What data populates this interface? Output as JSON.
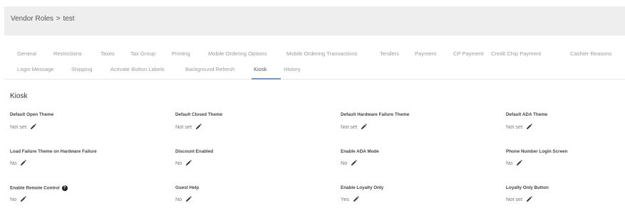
{
  "breadcrumb": {
    "parent": "Vendor Roles",
    "separator": ">",
    "current": "test"
  },
  "tabs": [
    {
      "label": "General"
    },
    {
      "label": "Restrictions"
    },
    {
      "label": "Taxes"
    },
    {
      "label": "Tax Group"
    },
    {
      "label": "Printing"
    },
    {
      "label": "Mobile Ordering Options"
    },
    {
      "label": "Mobile Ordering Transactions"
    },
    {
      "label": "Tenders"
    },
    {
      "label": "Payment"
    },
    {
      "label": "CP Payment"
    },
    {
      "label": "Credit Chip Payment"
    },
    {
      "label": "Cashier Reasons"
    },
    {
      "label": "Login Message"
    },
    {
      "label": "Shipping"
    },
    {
      "label": "Activate Button Labels"
    },
    {
      "label": "Background Refresh"
    },
    {
      "label": "Kiosk"
    },
    {
      "label": "History"
    }
  ],
  "active_tab": "Kiosk",
  "section": {
    "title": "Kiosk"
  },
  "fields": [
    {
      "label": "Default Open Theme",
      "value": "Not set"
    },
    {
      "label": "Default Closed Theme",
      "value": "Not set"
    },
    {
      "label": "Default Hardware Failure Theme",
      "value": "Not set"
    },
    {
      "label": "Default ADA Theme",
      "value": "Not set"
    },
    {
      "label": "Load Failure Theme on Hardware Failure",
      "value": "No"
    },
    {
      "label": "Discount Enabled",
      "value": "No"
    },
    {
      "label": "Enable ADA Mode",
      "value": "No"
    },
    {
      "label": "Phone Number Login Screen",
      "value": "No"
    },
    {
      "label": "Enable Remote Control",
      "value": "No",
      "help": "?"
    },
    {
      "label": "Guest Help",
      "value": "No"
    },
    {
      "label": "Enable Loyalty Only",
      "value": "Yes"
    },
    {
      "label": "Loyalty Only Button",
      "value": "Not set"
    }
  ],
  "icons": {
    "edit": "pencil-icon",
    "help": "question-circle-icon"
  },
  "colors": {
    "header_bg": "#eeeeee",
    "active_tab_underline": "#6f99c6"
  }
}
